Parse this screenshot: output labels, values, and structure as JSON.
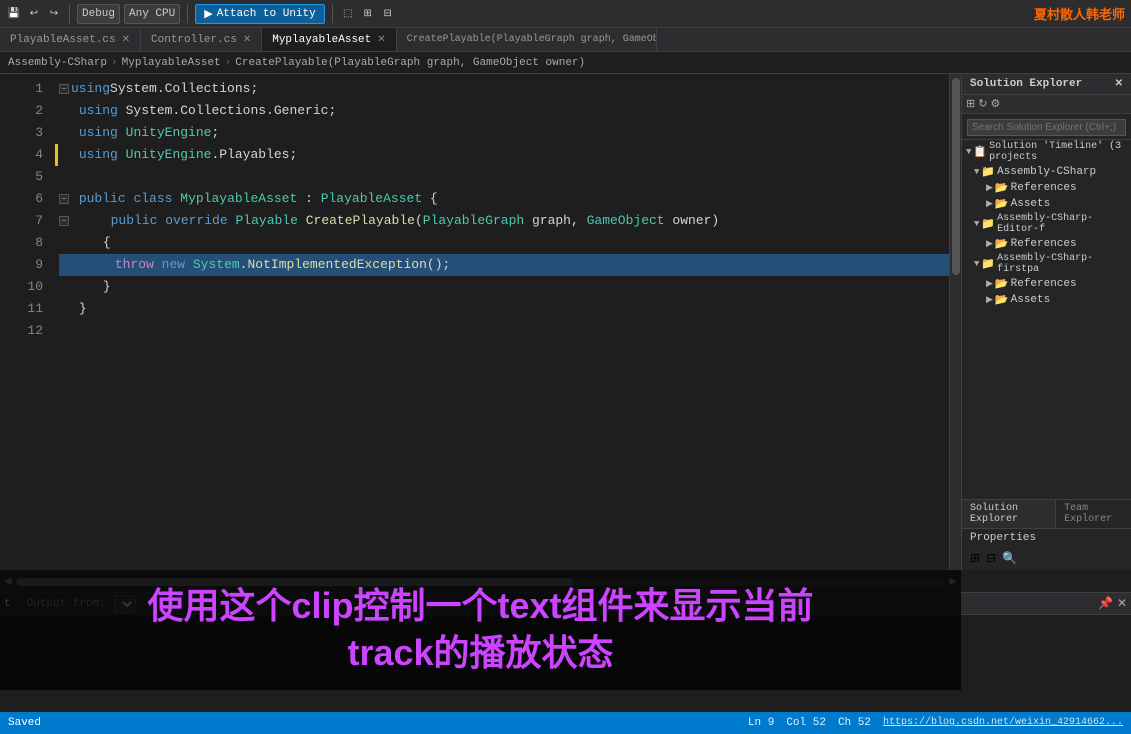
{
  "toolbar": {
    "debug_label": "Debug",
    "cpu_label": "Any CPU",
    "attach_unity": "Attach to Unity",
    "title_right": "夏村散人韩老师"
  },
  "tabs": [
    {
      "label": "PlayableAsset.cs",
      "active": false,
      "modified": false
    },
    {
      "label": "Controller.cs",
      "active": false,
      "modified": false
    },
    {
      "label": "MyplayableAsset",
      "active": true,
      "modified": false
    },
    {
      "label": "CreatePlayable(PlayableGraph graph, GameObject owner)",
      "active": false,
      "modified": false
    }
  ],
  "breadcrumbs": {
    "left": "Assembly-CSharp",
    "middle": "MyplayableAsset",
    "right": "CreatePlayable(PlayableGraph graph, GameObject owner)"
  },
  "code_lines": [
    {
      "num": 1,
      "content": "using System.Collections;"
    },
    {
      "num": 2,
      "content": "using System.Collections.Generic;"
    },
    {
      "num": 3,
      "content": "using UnityEngine;"
    },
    {
      "num": 4,
      "content": "using UnityEngine.Playables;"
    },
    {
      "num": 5,
      "content": ""
    },
    {
      "num": 6,
      "content": "public class MyplayableAsset : PlayableAsset {"
    },
    {
      "num": 7,
      "content": "    public override Playable CreatePlayable(PlayableGraph graph, GameObject owner)"
    },
    {
      "num": 8,
      "content": "    {"
    },
    {
      "num": 9,
      "content": "        throw new System.NotImplementedException();"
    },
    {
      "num": 10,
      "content": "    }"
    },
    {
      "num": 11,
      "content": "}"
    },
    {
      "num": 12,
      "content": ""
    }
  ],
  "solution_explorer": {
    "title": "Solution Explorer",
    "search_placeholder": "Search Solution Explorer (Ctrl+;)",
    "tree": [
      {
        "level": 0,
        "label": "Solution 'Timeline' (3 projects)",
        "icon": "📋",
        "expanded": true
      },
      {
        "level": 1,
        "label": "Assembly-CSharp",
        "icon": "📁",
        "expanded": true
      },
      {
        "level": 2,
        "label": "References",
        "icon": "📂",
        "expanded": false
      },
      {
        "level": 2,
        "label": "Assets",
        "icon": "📂",
        "expanded": false
      },
      {
        "level": 1,
        "label": "Assembly-CSharp-Editor-f",
        "icon": "📁",
        "expanded": true
      },
      {
        "level": 2,
        "label": "References",
        "icon": "📂",
        "expanded": false
      },
      {
        "level": 1,
        "label": "Assembly-CSharp-firstpa",
        "icon": "📁",
        "expanded": true
      },
      {
        "level": 2,
        "label": "References",
        "icon": "📂",
        "expanded": false
      },
      {
        "level": 2,
        "label": "Assets",
        "icon": "📂",
        "expanded": false
      }
    ]
  },
  "bottom_tabs": {
    "label": "t",
    "output_from": "Output from:"
  },
  "overlay": {
    "line1": "使用这个clip控制一个text组件来显示当前",
    "line2": "track的播放状态"
  },
  "status_bar": {
    "saved": "Saved",
    "ln": "Ln 9",
    "col": "Col 52",
    "ch": "Ch 52",
    "url": "https://blog.csdn.net/weixin_42914662..."
  },
  "sidebar_tabs": {
    "solution_explorer": "Solution Explorer",
    "team_explorer": "Team Explorer"
  },
  "properties": {
    "label": "Properties"
  }
}
